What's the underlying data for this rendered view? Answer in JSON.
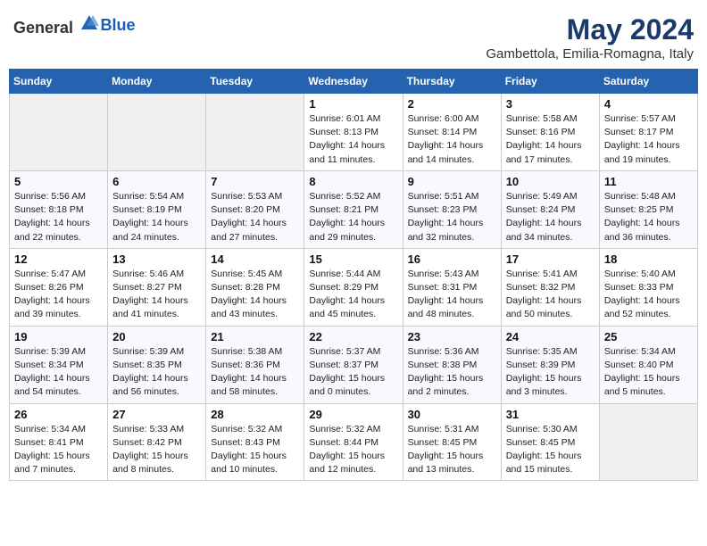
{
  "header": {
    "logo_general": "General",
    "logo_blue": "Blue",
    "title": "May 2024",
    "subtitle": "Gambettola, Emilia-Romagna, Italy"
  },
  "calendar": {
    "days_of_week": [
      "Sunday",
      "Monday",
      "Tuesday",
      "Wednesday",
      "Thursday",
      "Friday",
      "Saturday"
    ],
    "weeks": [
      [
        {
          "day": "",
          "info": ""
        },
        {
          "day": "",
          "info": ""
        },
        {
          "day": "",
          "info": ""
        },
        {
          "day": "1",
          "info": "Sunrise: 6:01 AM\nSunset: 8:13 PM\nDaylight: 14 hours\nand 11 minutes."
        },
        {
          "day": "2",
          "info": "Sunrise: 6:00 AM\nSunset: 8:14 PM\nDaylight: 14 hours\nand 14 minutes."
        },
        {
          "day": "3",
          "info": "Sunrise: 5:58 AM\nSunset: 8:16 PM\nDaylight: 14 hours\nand 17 minutes."
        },
        {
          "day": "4",
          "info": "Sunrise: 5:57 AM\nSunset: 8:17 PM\nDaylight: 14 hours\nand 19 minutes."
        }
      ],
      [
        {
          "day": "5",
          "info": "Sunrise: 5:56 AM\nSunset: 8:18 PM\nDaylight: 14 hours\nand 22 minutes."
        },
        {
          "day": "6",
          "info": "Sunrise: 5:54 AM\nSunset: 8:19 PM\nDaylight: 14 hours\nand 24 minutes."
        },
        {
          "day": "7",
          "info": "Sunrise: 5:53 AM\nSunset: 8:20 PM\nDaylight: 14 hours\nand 27 minutes."
        },
        {
          "day": "8",
          "info": "Sunrise: 5:52 AM\nSunset: 8:21 PM\nDaylight: 14 hours\nand 29 minutes."
        },
        {
          "day": "9",
          "info": "Sunrise: 5:51 AM\nSunset: 8:23 PM\nDaylight: 14 hours\nand 32 minutes."
        },
        {
          "day": "10",
          "info": "Sunrise: 5:49 AM\nSunset: 8:24 PM\nDaylight: 14 hours\nand 34 minutes."
        },
        {
          "day": "11",
          "info": "Sunrise: 5:48 AM\nSunset: 8:25 PM\nDaylight: 14 hours\nand 36 minutes."
        }
      ],
      [
        {
          "day": "12",
          "info": "Sunrise: 5:47 AM\nSunset: 8:26 PM\nDaylight: 14 hours\nand 39 minutes."
        },
        {
          "day": "13",
          "info": "Sunrise: 5:46 AM\nSunset: 8:27 PM\nDaylight: 14 hours\nand 41 minutes."
        },
        {
          "day": "14",
          "info": "Sunrise: 5:45 AM\nSunset: 8:28 PM\nDaylight: 14 hours\nand 43 minutes."
        },
        {
          "day": "15",
          "info": "Sunrise: 5:44 AM\nSunset: 8:29 PM\nDaylight: 14 hours\nand 45 minutes."
        },
        {
          "day": "16",
          "info": "Sunrise: 5:43 AM\nSunset: 8:31 PM\nDaylight: 14 hours\nand 48 minutes."
        },
        {
          "day": "17",
          "info": "Sunrise: 5:41 AM\nSunset: 8:32 PM\nDaylight: 14 hours\nand 50 minutes."
        },
        {
          "day": "18",
          "info": "Sunrise: 5:40 AM\nSunset: 8:33 PM\nDaylight: 14 hours\nand 52 minutes."
        }
      ],
      [
        {
          "day": "19",
          "info": "Sunrise: 5:39 AM\nSunset: 8:34 PM\nDaylight: 14 hours\nand 54 minutes."
        },
        {
          "day": "20",
          "info": "Sunrise: 5:39 AM\nSunset: 8:35 PM\nDaylight: 14 hours\nand 56 minutes."
        },
        {
          "day": "21",
          "info": "Sunrise: 5:38 AM\nSunset: 8:36 PM\nDaylight: 14 hours\nand 58 minutes."
        },
        {
          "day": "22",
          "info": "Sunrise: 5:37 AM\nSunset: 8:37 PM\nDaylight: 15 hours\nand 0 minutes."
        },
        {
          "day": "23",
          "info": "Sunrise: 5:36 AM\nSunset: 8:38 PM\nDaylight: 15 hours\nand 2 minutes."
        },
        {
          "day": "24",
          "info": "Sunrise: 5:35 AM\nSunset: 8:39 PM\nDaylight: 15 hours\nand 3 minutes."
        },
        {
          "day": "25",
          "info": "Sunrise: 5:34 AM\nSunset: 8:40 PM\nDaylight: 15 hours\nand 5 minutes."
        }
      ],
      [
        {
          "day": "26",
          "info": "Sunrise: 5:34 AM\nSunset: 8:41 PM\nDaylight: 15 hours\nand 7 minutes."
        },
        {
          "day": "27",
          "info": "Sunrise: 5:33 AM\nSunset: 8:42 PM\nDaylight: 15 hours\nand 8 minutes."
        },
        {
          "day": "28",
          "info": "Sunrise: 5:32 AM\nSunset: 8:43 PM\nDaylight: 15 hours\nand 10 minutes."
        },
        {
          "day": "29",
          "info": "Sunrise: 5:32 AM\nSunset: 8:44 PM\nDaylight: 15 hours\nand 12 minutes."
        },
        {
          "day": "30",
          "info": "Sunrise: 5:31 AM\nSunset: 8:45 PM\nDaylight: 15 hours\nand 13 minutes."
        },
        {
          "day": "31",
          "info": "Sunrise: 5:30 AM\nSunset: 8:45 PM\nDaylight: 15 hours\nand 15 minutes."
        },
        {
          "day": "",
          "info": ""
        }
      ]
    ]
  }
}
